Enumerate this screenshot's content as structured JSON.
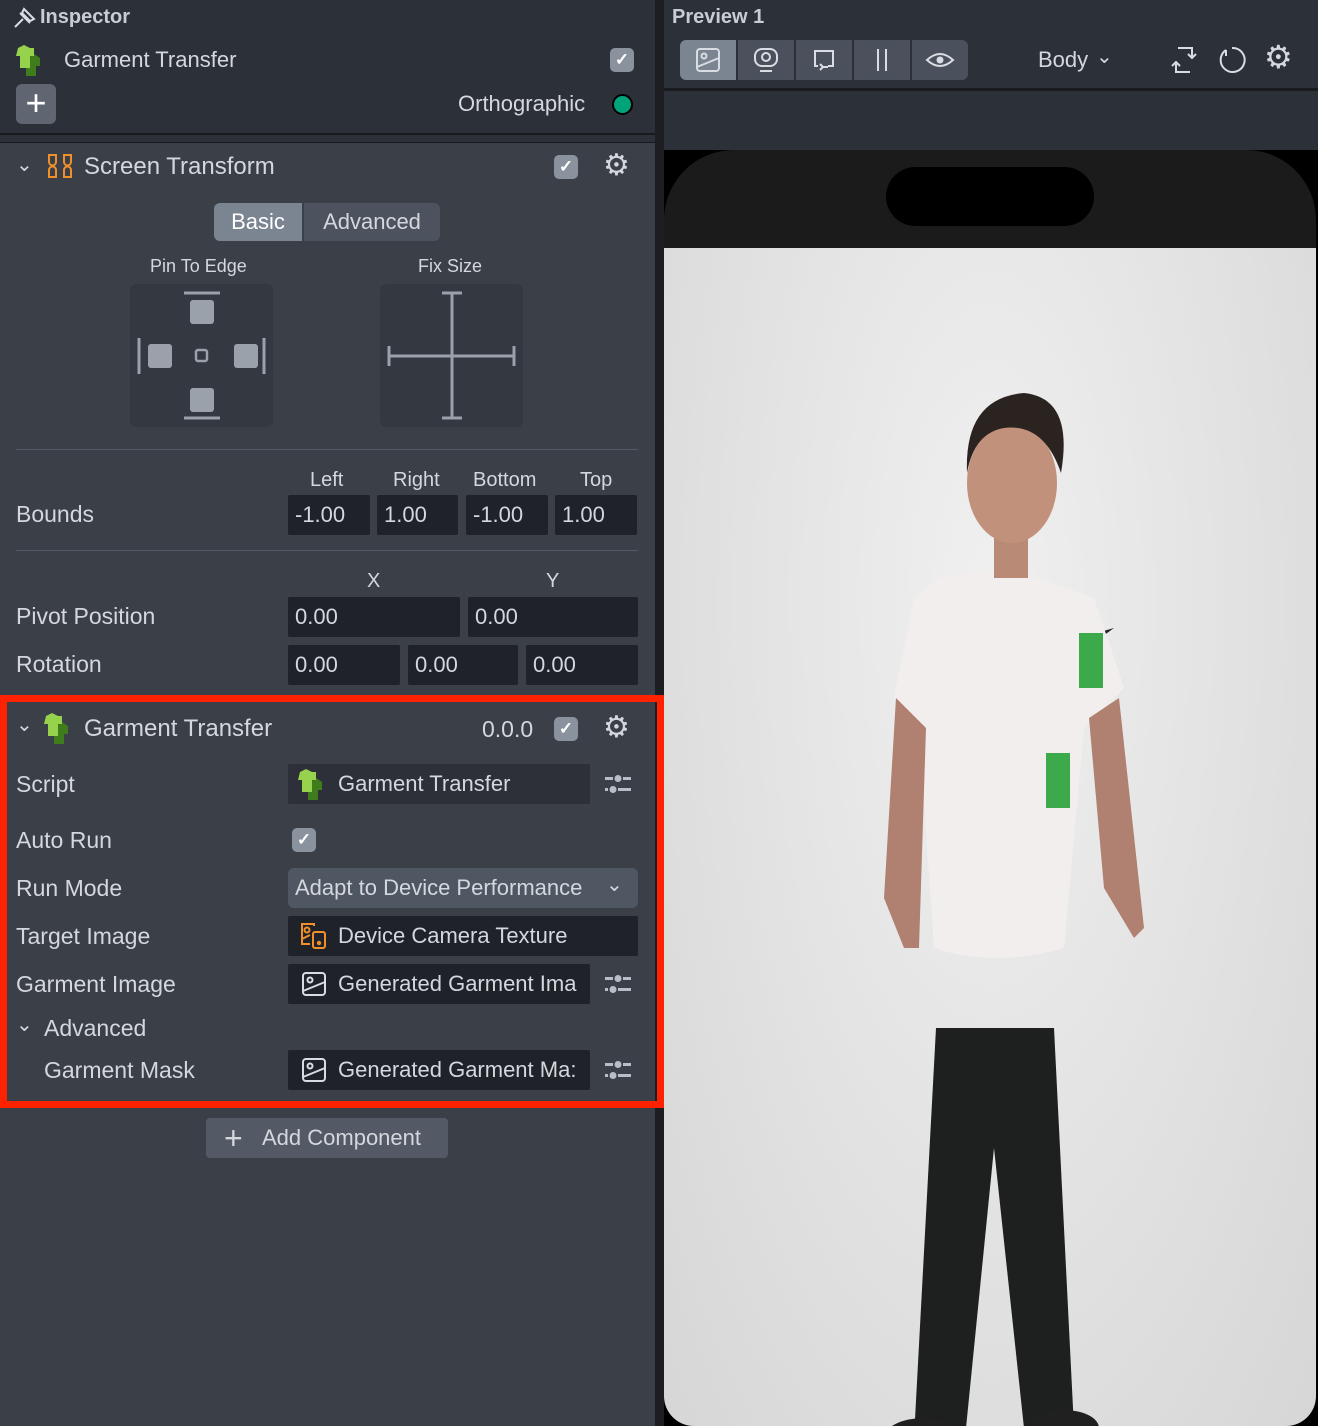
{
  "inspector": {
    "title": "Inspector",
    "object_name": "Garment Transfer",
    "object_enabled": true,
    "camera_type": "Orthographic",
    "camera_color": "#00a37a"
  },
  "screen_transform": {
    "title": "Screen Transform",
    "enabled": true,
    "tabs": [
      "Basic",
      "Advanced"
    ],
    "active_tab": "Basic",
    "pin_label": "Pin To Edge",
    "fix_label": "Fix Size",
    "bounds_label": "Bounds",
    "bounds_headers": [
      "Left",
      "Right",
      "Bottom",
      "Top"
    ],
    "bounds_values": [
      "-1.00",
      "1.00",
      "-1.00",
      "1.00"
    ],
    "pivot_label": "Pivot Position",
    "pivot_headers": [
      "X",
      "Y"
    ],
    "pivot_values": [
      "0.00",
      "0.00"
    ],
    "rotation_label": "Rotation",
    "rotation_values": [
      "0.00",
      "0.00",
      "0.00"
    ]
  },
  "garment_component": {
    "title": "Garment Transfer",
    "version": "0.0.0",
    "enabled": true,
    "script_label": "Script",
    "script_value": "Garment Transfer",
    "auto_run_label": "Auto Run",
    "auto_run": true,
    "run_mode_label": "Run Mode",
    "run_mode_value": "Adapt to Device Performance",
    "target_label": "Target Image",
    "target_value": "Device Camera Texture",
    "garment_image_label": "Garment Image",
    "garment_image_value": "Generated Garment Ima",
    "advanced_label": "Advanced",
    "garment_mask_label": "Garment Mask",
    "garment_mask_value": "Generated Garment Ma:",
    "highlight_color": "#ff2200"
  },
  "add_component": "Add Component",
  "preview": {
    "title": "Preview 1",
    "tracking_mode": "Body"
  }
}
